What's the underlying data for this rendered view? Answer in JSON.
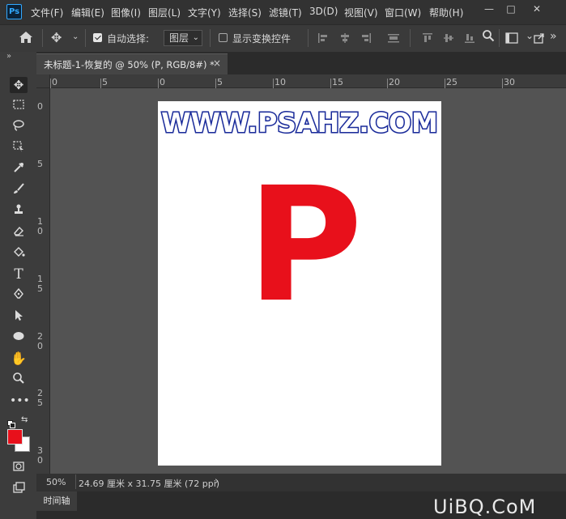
{
  "app": {
    "logo_text": "Ps",
    "menu": [
      "文件(F)",
      "编辑(E)",
      "图像(I)",
      "图层(L)",
      "文字(Y)",
      "选择(S)",
      "滤镜(T)",
      "3D(D)",
      "视图(V)",
      "窗口(W)",
      "帮助(H)"
    ],
    "window_buttons": [
      "—",
      "□",
      "✕"
    ]
  },
  "options_bar": {
    "auto_select_label": "自动选择:",
    "auto_select_checked": true,
    "layer_dropdown_value": "图层",
    "show_transform_label": "显示变换控件",
    "show_transform_checked": false
  },
  "document_tab": {
    "title": "未标题-1-恢复的 @ 50% (P, RGB/8#) *",
    "close": "×"
  },
  "ruler": {
    "top_labels": [
      "0",
      "5",
      "0",
      "5",
      "10",
      "15",
      "20",
      "25",
      "30"
    ],
    "left_labels": [
      "0",
      "5",
      "1\n0",
      "1\n5",
      "2\n0",
      "2\n5",
      "3\n0"
    ]
  },
  "canvas": {
    "watermark": "WWW.PSAHZ.COM",
    "letter": "P",
    "letter_color": "#e8101b",
    "background": "#ffffff"
  },
  "status": {
    "zoom": "50%",
    "doc_size": "24.69 厘米 x 31.75 厘米 (72 ppi)",
    "arrow": "›"
  },
  "panel": {
    "timeline_tab": "时间轴"
  },
  "brand": {
    "text": "UiBQ.CoM"
  },
  "colors": {
    "foreground": "#e8101b",
    "background": "#ffffff",
    "accent": "#31a8ff"
  }
}
